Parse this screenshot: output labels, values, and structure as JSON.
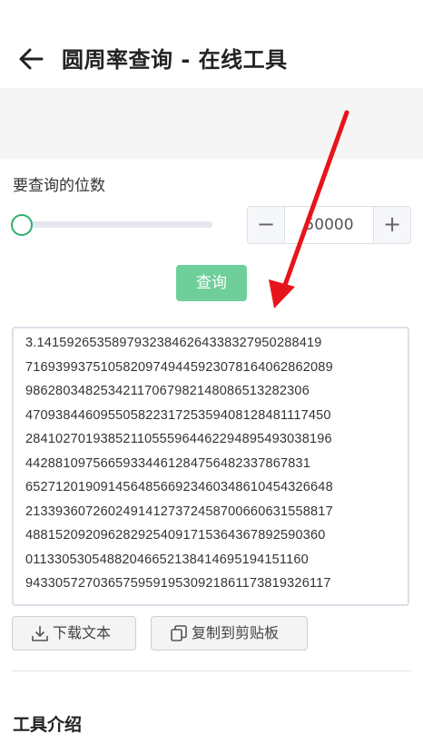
{
  "header": {
    "title": "圆周率查询 - 在线工具"
  },
  "form": {
    "digits_label": "要查询的位数",
    "slider_fraction": 0.0,
    "stepper_value": "50000",
    "minus_label": "−",
    "plus_label": "+",
    "query_label": "查询"
  },
  "result": {
    "lines": [
      "3.14159265358979323846264338327950288419",
      "71693993751058209749445923078164062862089",
      "98628034825342117067982148086513282306",
      "47093844609550582231725359408128481117450",
      "28410270193852110555964462294895493038196",
      "44288109756659334461284756482337867831",
      "65271201909145648566923460348610454326648",
      "21339360726024914127372458700660631558817",
      "4881520920962829254091715364367892590360",
      "01133053054882046652138414695194151160",
      "94330572703657595919530921861173819326117"
    ]
  },
  "actions": {
    "download_label": "下载文本",
    "copy_label": "复制到剪贴板"
  },
  "section": {
    "title": "工具介绍"
  },
  "colors": {
    "accent": "#2fae6e",
    "query_button": "#6fcf9a",
    "annotation_arrow": "#e8141c"
  }
}
